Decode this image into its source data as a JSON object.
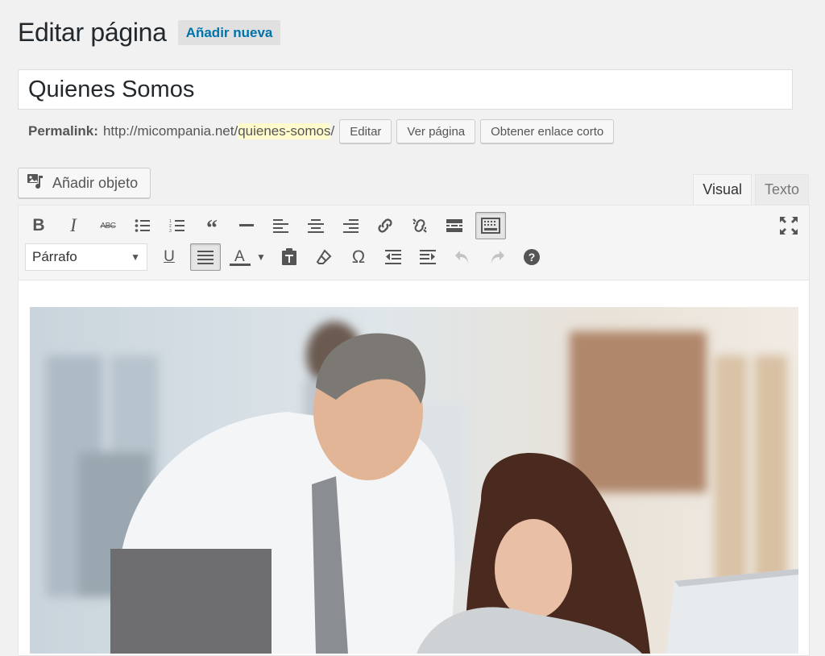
{
  "header": {
    "title": "Editar página",
    "add_new": "Añadir nueva"
  },
  "post": {
    "title": "Quienes Somos"
  },
  "permalink": {
    "label": "Permalink:",
    "base": "http://micompania.net/",
    "slug": "quienes-somos",
    "trail": "/",
    "edit": "Editar",
    "view": "Ver página",
    "shortlink": "Obtener enlace corto"
  },
  "media": {
    "label": "Añadir objeto",
    "icon": "media-add-icon"
  },
  "tabs": {
    "visual": "Visual",
    "text": "Texto",
    "active": "visual"
  },
  "toolbar": {
    "format_select": "Párrafo",
    "row1": [
      "bold",
      "italic",
      "strikethrough",
      "bullet-list",
      "numbered-list",
      "blockquote",
      "horizontal-line",
      "align-left",
      "align-center",
      "align-right",
      "insert-link",
      "remove-link",
      "insert-more",
      "toolbar-toggle"
    ],
    "row2": [
      "underline",
      "justify",
      "text-color",
      "paste-as-text",
      "clear-formatting",
      "special-character",
      "outdent",
      "indent",
      "undo",
      "redo",
      "help"
    ]
  },
  "colors": {
    "accent": "#0073aa",
    "slug_highlight": "#fffbcc",
    "background": "#f1f1f1"
  }
}
